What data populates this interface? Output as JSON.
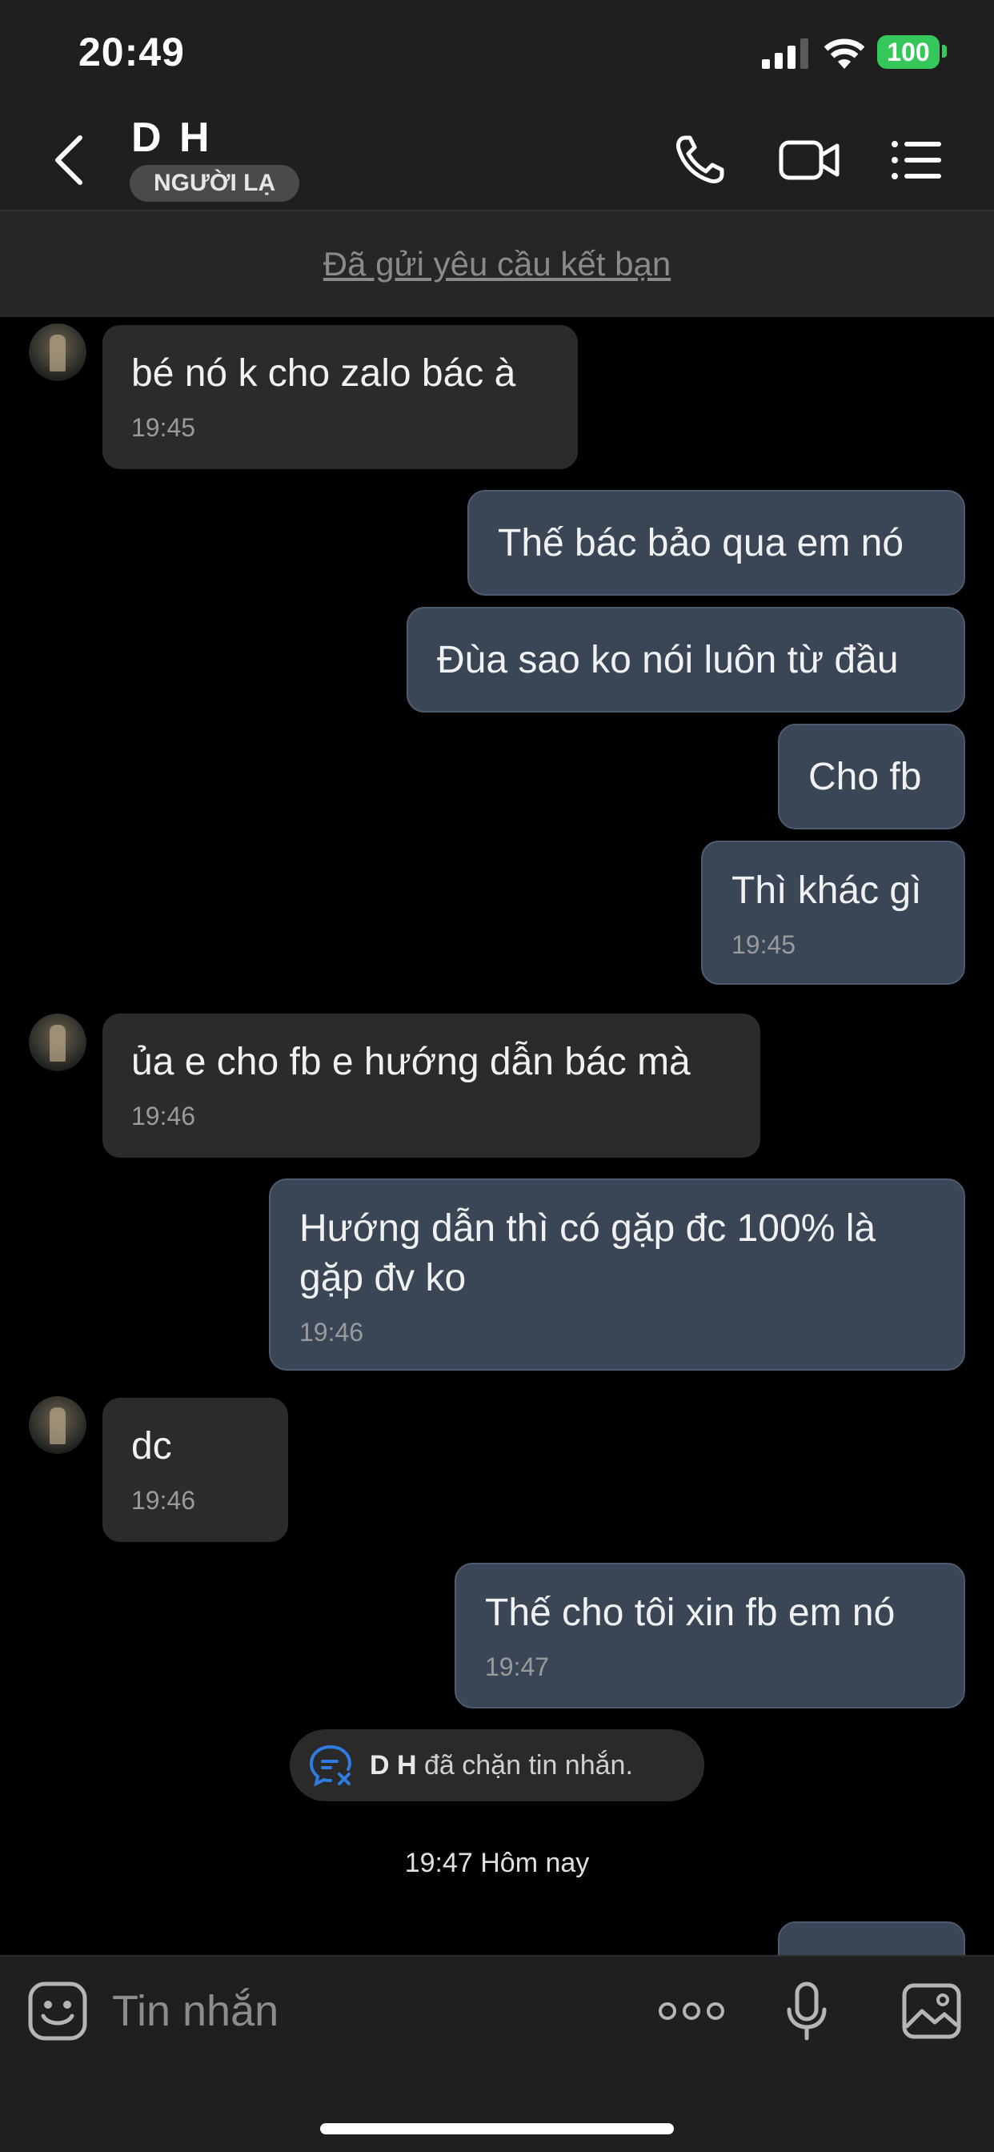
{
  "status_bar": {
    "time": "20:49",
    "battery": "100"
  },
  "header": {
    "name": "D H",
    "badge": "NGƯỜI LẠ"
  },
  "banner": {
    "link": "Đã gửi yêu cầu kết bạn"
  },
  "messages": [
    {
      "dir": "in",
      "text": "bé nó k cho zalo bác à",
      "time": "19:45"
    },
    {
      "dir": "out",
      "text": "Thế bác bảo qua em nó",
      "time": ""
    },
    {
      "dir": "out",
      "text": "Đùa sao ko nói luôn từ đầu",
      "time": ""
    },
    {
      "dir": "out",
      "text": "Cho fb",
      "time": ""
    },
    {
      "dir": "out",
      "text": "Thì khác gì",
      "time": "19:45"
    },
    {
      "dir": "in",
      "text": "ủa e cho fb e hướng dẫn bác mà",
      "time": "19:46"
    },
    {
      "dir": "out",
      "text": "Hướng dẫn thì có gặp đc 100% là gặp đv ko",
      "time": "19:46"
    },
    {
      "dir": "in",
      "text": "dc",
      "time": "19:46"
    },
    {
      "dir": "out",
      "text": "Thế cho tôi xin fb em nó",
      "time": "19:47"
    }
  ],
  "block_notice": {
    "name": "D H",
    "text": " đã chặn tin nhắn."
  },
  "date_separator": "19:47 Hôm nay",
  "input": {
    "placeholder": "Tin nhắn"
  },
  "icons": {
    "header": [
      "back-icon",
      "phone-icon",
      "video-call-icon",
      "menu-icon"
    ],
    "input": [
      "sticker-icon",
      "more-icon",
      "microphone-icon",
      "image-icon"
    ]
  },
  "colors": {
    "outgoing_bubble": "#3a4555",
    "incoming_bubble": "#2b2b2b",
    "battery": "#35c759",
    "block_icon": "#2f7be0"
  }
}
